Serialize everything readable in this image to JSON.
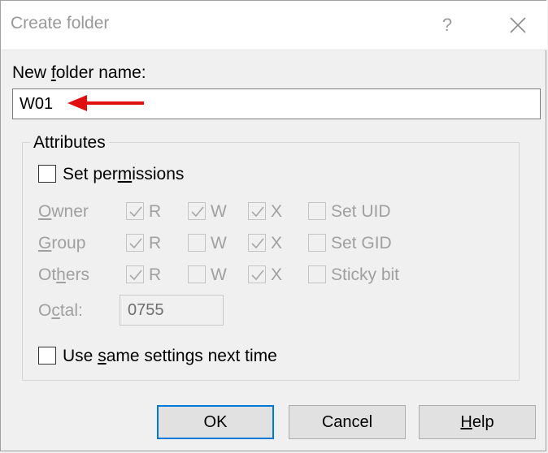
{
  "window": {
    "title": "Create folder",
    "help_label": "?"
  },
  "folder_name": {
    "label_before": "New ",
    "label_key": "f",
    "label_after": "older name:",
    "value": "W01"
  },
  "attributes": {
    "title": "Attributes",
    "set_permissions": {
      "label_before": "Set per",
      "label_key": "m",
      "label_after": "issions",
      "checked": false
    },
    "rows": [
      {
        "label_key": "O",
        "label_rest": "wner",
        "r": {
          "label": "R",
          "checked": true
        },
        "w": {
          "label": "W",
          "checked": true
        },
        "x": {
          "label": "X",
          "checked": true
        },
        "special": {
          "label": "Set UID",
          "checked": false
        }
      },
      {
        "label_key": "G",
        "label_rest": "roup",
        "r": {
          "label": "R",
          "checked": true
        },
        "w": {
          "label": "W",
          "checked": false
        },
        "x": {
          "label": "X",
          "checked": true
        },
        "special": {
          "label": "Set GID",
          "checked": false
        }
      },
      {
        "label_before": "Ot",
        "label_key": "h",
        "label_after": "ers",
        "r": {
          "label": "R",
          "checked": true
        },
        "w": {
          "label": "W",
          "checked": false
        },
        "x": {
          "label": "X",
          "checked": true
        },
        "special": {
          "label": "Sticky bit",
          "checked": false
        }
      }
    ],
    "octal": {
      "label_before": "O",
      "label_key": "c",
      "label_after": "tal:",
      "value": "0755"
    },
    "same_settings": {
      "label_before": "Use ",
      "label_key": "s",
      "label_after": "ame settings next time",
      "checked": false
    }
  },
  "buttons": {
    "ok": "OK",
    "cancel": "Cancel",
    "help_key": "H",
    "help_rest": "elp"
  },
  "colors": {
    "arrow": "#e01010",
    "default_button_border": "#0078d7",
    "disabled_text": "#a0a0a0"
  },
  "icons": {
    "close": "close-icon",
    "check": "checkmark-icon",
    "arrow": "red-arrow-icon"
  }
}
